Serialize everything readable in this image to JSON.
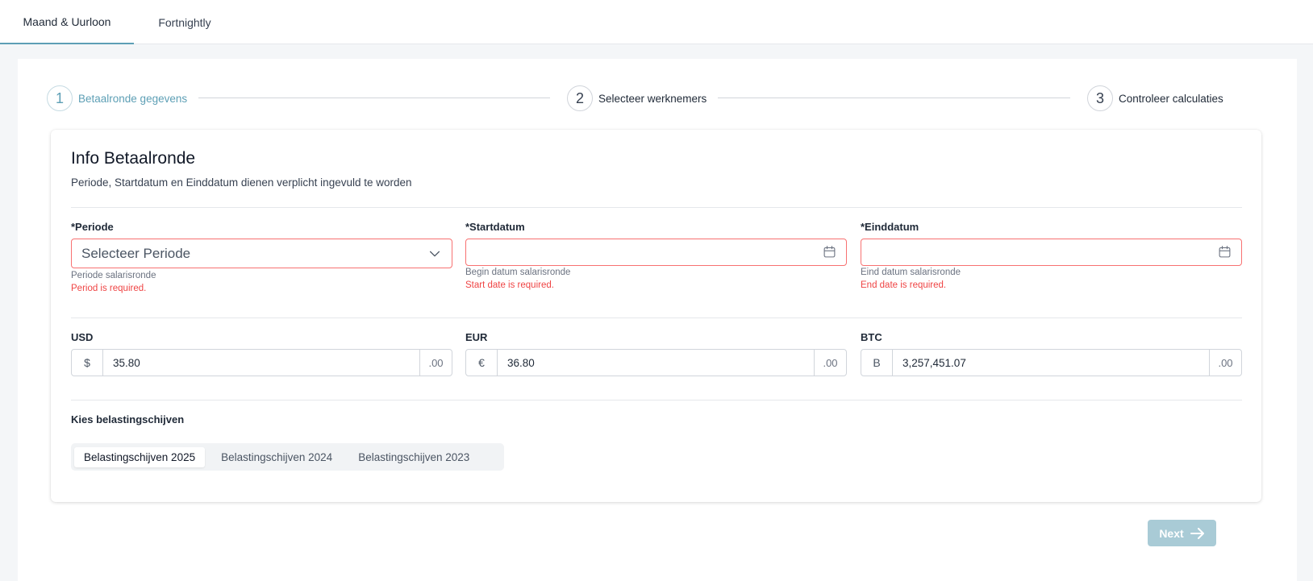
{
  "tabs": [
    {
      "label": "Maand & Uurloon",
      "active": true
    },
    {
      "label": "Fortnightly",
      "active": false
    }
  ],
  "stepper": [
    {
      "number": "1",
      "label": "Betaalronde gegevens",
      "active": true
    },
    {
      "number": "2",
      "label": "Selecteer werknemers",
      "active": false
    },
    {
      "number": "3",
      "label": "Controleer calculaties",
      "active": false
    }
  ],
  "card": {
    "title": "Info Betaalronde",
    "subtitle": "Periode, Startdatum en Einddatum dienen verplicht ingevuld te worden"
  },
  "fields": {
    "periode": {
      "label": "*Periode",
      "placeholder": "Selecteer Periode",
      "help": "Periode salarisronde",
      "error": "Period is required."
    },
    "startdatum": {
      "label": "*Startdatum",
      "value": "",
      "help": "Begin datum salarisronde",
      "error": "Start date is required."
    },
    "einddatum": {
      "label": "*Einddatum",
      "value": "",
      "help": "Eind datum salarisronde",
      "error": "End date is required."
    }
  },
  "currencies": [
    {
      "label": "USD",
      "prefix": "$",
      "value": "35.80",
      "suffix": ".00"
    },
    {
      "label": "EUR",
      "prefix": "€",
      "value": "36.80",
      "suffix": ".00"
    },
    {
      "label": "BTC",
      "prefix": "B",
      "value": "3,257,451.07",
      "suffix": ".00"
    }
  ],
  "tax": {
    "label": "Kies belastingschijven",
    "options": [
      "Belastingschijven 2025",
      "Belastingschijven 2024",
      "Belastingschijven 2023"
    ],
    "selected": "Belastingschijven 2025"
  },
  "next_label": "Next",
  "colors": {
    "accent": "#5d9fb5",
    "error": "#ef4444",
    "next_disabled": "#a9cbd6"
  },
  "icons": {
    "select": "chevron-down-icon",
    "date": "calendar-icon",
    "next": "arrow-right-icon"
  }
}
